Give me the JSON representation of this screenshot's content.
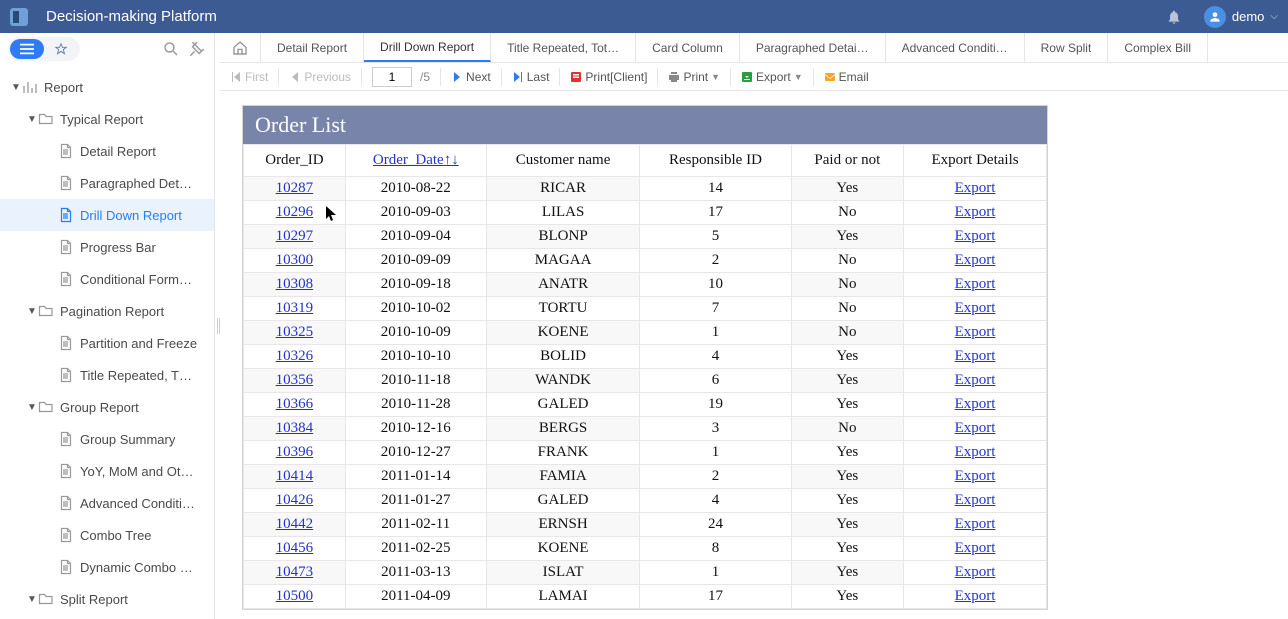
{
  "header": {
    "app_title": "Decision-making Platform",
    "user_name": "demo"
  },
  "sidebar_mode": {
    "list_active": true
  },
  "tree": [
    {
      "lvl": 0,
      "kind": "root",
      "expanded": true,
      "label": "Report"
    },
    {
      "lvl": 1,
      "kind": "folder",
      "expanded": true,
      "label": "Typical Report"
    },
    {
      "lvl": 2,
      "kind": "doc",
      "label": "Detail Report"
    },
    {
      "lvl": 2,
      "kind": "doc",
      "label": "Paragraphed Det…"
    },
    {
      "lvl": 2,
      "kind": "doc",
      "label": "Drill Down Report",
      "selected": true
    },
    {
      "lvl": 2,
      "kind": "doc",
      "label": "Progress Bar"
    },
    {
      "lvl": 2,
      "kind": "doc",
      "label": "Conditional Form…"
    },
    {
      "lvl": 1,
      "kind": "folder",
      "expanded": true,
      "label": "Pagination Report"
    },
    {
      "lvl": 2,
      "kind": "doc",
      "label": "Partition and Freeze"
    },
    {
      "lvl": 2,
      "kind": "doc",
      "label": "Title Repeated, T…"
    },
    {
      "lvl": 1,
      "kind": "folder",
      "expanded": true,
      "label": "Group Report"
    },
    {
      "lvl": 2,
      "kind": "doc",
      "label": "Group Summary"
    },
    {
      "lvl": 2,
      "kind": "doc",
      "label": "YoY, MoM and Ot…"
    },
    {
      "lvl": 2,
      "kind": "doc",
      "label": "Advanced Conditi…"
    },
    {
      "lvl": 2,
      "kind": "doc",
      "label": "Combo Tree"
    },
    {
      "lvl": 2,
      "kind": "doc",
      "label": "Dynamic Combo …"
    },
    {
      "lvl": 1,
      "kind": "folder",
      "expanded": true,
      "label": "Split Report"
    }
  ],
  "tabs": [
    {
      "id": "home",
      "label": "",
      "home": true
    },
    {
      "id": "detail",
      "label": "Detail Report"
    },
    {
      "id": "drill",
      "label": "Drill Down Report",
      "active": true
    },
    {
      "id": "title",
      "label": "Title Repeated, Tot…"
    },
    {
      "id": "card",
      "label": "Card Column"
    },
    {
      "id": "para",
      "label": "Paragraphed Detai…"
    },
    {
      "id": "adv",
      "label": "Advanced Conditi…"
    },
    {
      "id": "row",
      "label": "Row Split"
    },
    {
      "id": "comp",
      "label": "Complex Bill"
    }
  ],
  "toolbar": {
    "first": "First",
    "previous": "Previous",
    "page_value": "1",
    "page_total": "/5",
    "next": "Next",
    "last": "Last",
    "print_client": "Print[Client]",
    "print": "Print",
    "export": "Export",
    "email": "Email"
  },
  "report": {
    "title": "Order List",
    "columns": [
      "Order_ID",
      "Order_Date",
      "Customer name",
      "Responsible ID",
      "Paid or not",
      "Export Details"
    ],
    "sort_indicator": "↑↓",
    "export_label": "Export",
    "rows": [
      {
        "id": "10287",
        "date": "2010-08-22",
        "cust": "RICAR",
        "resp": "14",
        "paid": "Yes"
      },
      {
        "id": "10296",
        "date": "2010-09-03",
        "cust": "LILAS",
        "resp": "17",
        "paid": "No"
      },
      {
        "id": "10297",
        "date": "2010-09-04",
        "cust": "BLONP",
        "resp": "5",
        "paid": "Yes"
      },
      {
        "id": "10300",
        "date": "2010-09-09",
        "cust": "MAGAA",
        "resp": "2",
        "paid": "No"
      },
      {
        "id": "10308",
        "date": "2010-09-18",
        "cust": "ANATR",
        "resp": "10",
        "paid": "No"
      },
      {
        "id": "10319",
        "date": "2010-10-02",
        "cust": "TORTU",
        "resp": "7",
        "paid": "No"
      },
      {
        "id": "10325",
        "date": "2010-10-09",
        "cust": "KOENE",
        "resp": "1",
        "paid": "No"
      },
      {
        "id": "10326",
        "date": "2010-10-10",
        "cust": "BOLID",
        "resp": "4",
        "paid": "Yes"
      },
      {
        "id": "10356",
        "date": "2010-11-18",
        "cust": "WANDK",
        "resp": "6",
        "paid": "Yes"
      },
      {
        "id": "10366",
        "date": "2010-11-28",
        "cust": "GALED",
        "resp": "19",
        "paid": "Yes"
      },
      {
        "id": "10384",
        "date": "2010-12-16",
        "cust": "BERGS",
        "resp": "3",
        "paid": "No"
      },
      {
        "id": "10396",
        "date": "2010-12-27",
        "cust": "FRANK",
        "resp": "1",
        "paid": "Yes"
      },
      {
        "id": "10414",
        "date": "2011-01-14",
        "cust": "FAMIA",
        "resp": "2",
        "paid": "Yes"
      },
      {
        "id": "10426",
        "date": "2011-01-27",
        "cust": "GALED",
        "resp": "4",
        "paid": "Yes"
      },
      {
        "id": "10442",
        "date": "2011-02-11",
        "cust": "ERNSH",
        "resp": "24",
        "paid": "Yes"
      },
      {
        "id": "10456",
        "date": "2011-02-25",
        "cust": "KOENE",
        "resp": "8",
        "paid": "Yes"
      },
      {
        "id": "10473",
        "date": "2011-03-13",
        "cust": "ISLAT",
        "resp": "1",
        "paid": "Yes"
      },
      {
        "id": "10500",
        "date": "2011-04-09",
        "cust": "LAMAI",
        "resp": "17",
        "paid": "Yes"
      }
    ]
  }
}
